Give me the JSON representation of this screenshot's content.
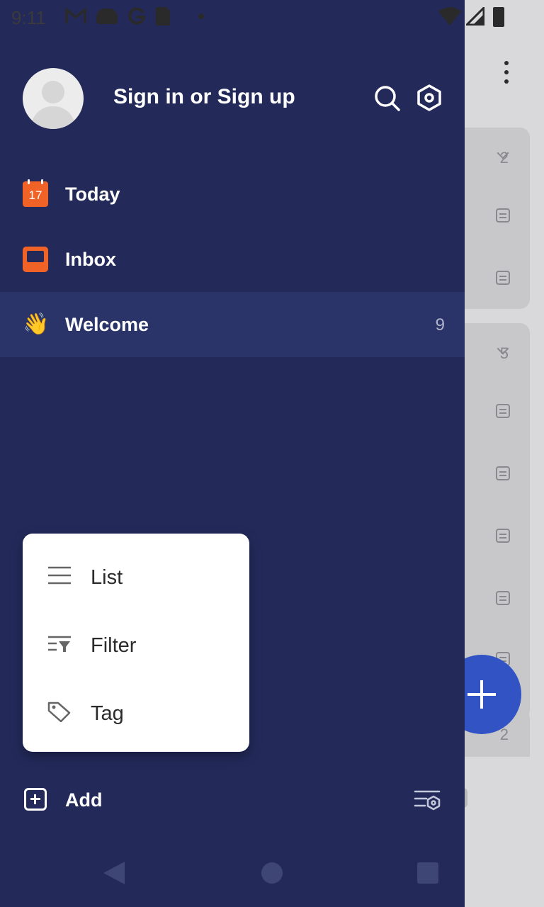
{
  "status_bar": {
    "time": "9:11",
    "left_icons": [
      "gmail-icon",
      "cloud-icon",
      "google-icon",
      "sd-card-icon",
      "dot-icon"
    ],
    "right_icons": [
      "wifi-icon",
      "signal-icon",
      "battery-icon"
    ]
  },
  "drawer": {
    "header": {
      "sign_in_label": "Sign in or Sign up",
      "icons": [
        "search-icon",
        "settings-icon"
      ]
    },
    "nav_items": [
      {
        "label": "Today",
        "icon": "calendar-icon",
        "icon_text": "17",
        "count": ""
      },
      {
        "label": "Inbox",
        "icon": "inbox-icon",
        "count": ""
      },
      {
        "label": "Welcome",
        "icon": "waving-hand-icon",
        "icon_text": "👋",
        "count": "9",
        "active": true
      }
    ],
    "add_label": "Add",
    "manage_icon": "list-settings-icon",
    "accent_color": "#f06226",
    "background_color": "#232a5a",
    "active_background_color": "#2b3468"
  },
  "popup_menu": {
    "items": [
      {
        "label": "List",
        "icon": "list-icon"
      },
      {
        "label": "Filter",
        "icon": "filter-icon"
      },
      {
        "label": "Tag",
        "icon": "tag-icon"
      }
    ]
  },
  "background_app": {
    "group_counts": [
      "2",
      "5",
      "2"
    ],
    "fab_icon": "plus-icon",
    "fab_color": "#3253c4"
  },
  "system_nav": {
    "buttons": [
      "back-button",
      "home-button",
      "recents-button"
    ]
  }
}
